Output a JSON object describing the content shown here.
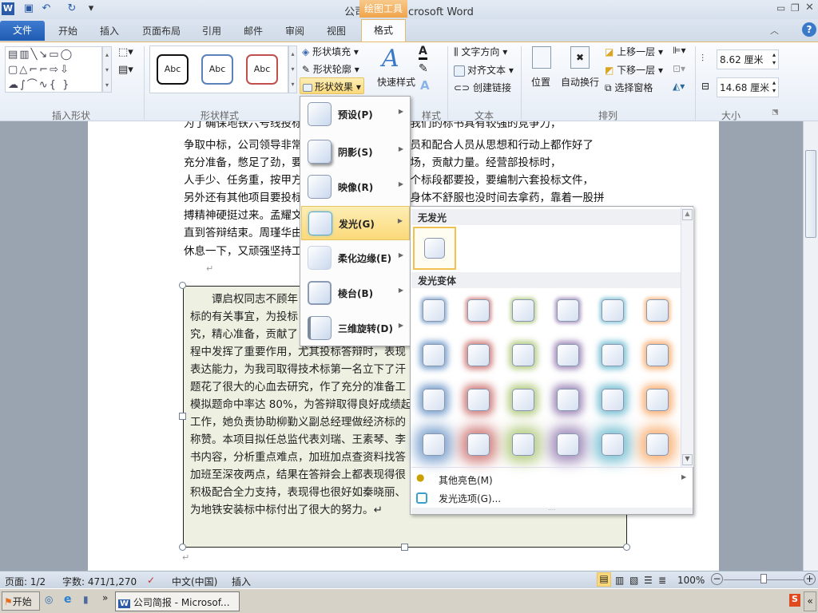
{
  "window": {
    "title": "公司简报 - Microsoft Word",
    "contextual_tab": "绘图工具",
    "controls": [
      "minimize",
      "restore",
      "close"
    ]
  },
  "quick_access": [
    "word-icon",
    "save-icon",
    "undo-icon",
    "redo-icon",
    "customize-icon"
  ],
  "tabs": {
    "file": "文件",
    "items": [
      "开始",
      "插入",
      "页面布局",
      "引用",
      "邮件",
      "审阅",
      "视图"
    ],
    "active": "格式"
  },
  "ribbon": {
    "insert_shapes": {
      "label": "插入形状"
    },
    "shape_styles": {
      "label": "形状样式",
      "gallery": [
        "Abc",
        "Abc",
        "Abc"
      ],
      "fill": "形状填充",
      "outline": "形状轮廓",
      "effects": "形状效果"
    },
    "wordart": {
      "quick_styles": "快速样式",
      "label": "样式"
    },
    "text": {
      "label": "文本",
      "direction": "文字方向",
      "align": "对齐文本",
      "link": "创建链接"
    },
    "arrange": {
      "label": "排列",
      "position": "位置",
      "wrap": "自动换行",
      "forward": "上移一层",
      "backward": "下移一层",
      "pane": "选择窗格"
    },
    "size": {
      "label": "大小",
      "height": "8.62 厘米",
      "width": "14.68 厘米"
    }
  },
  "effects_menu": {
    "items": [
      {
        "label": "预设(P)"
      },
      {
        "label": "阴影(S)"
      },
      {
        "label": "映像(R)"
      },
      {
        "label": "发光(G)",
        "highlighted": true
      },
      {
        "label": "柔化边缘(E)"
      },
      {
        "label": "棱台(B)"
      },
      {
        "label": "三维旋转(D)"
      }
    ]
  },
  "glow_menu": {
    "no_glow_header": "无发光",
    "variants_header": "发光变体",
    "colors": [
      "#4f81bd",
      "#c0504d",
      "#9bbb59",
      "#8064a2",
      "#4bacc6",
      "#f79646"
    ],
    "sizes_pt": [
      5,
      8,
      11,
      18
    ],
    "more_colors": "其他亮色(M)",
    "options": "发光选项(G)..."
  },
  "document": {
    "lines": [
      "为了确保地铁六号线投标工作按时间进度，确保我们的标书具有较强的竞争力，",
      "争取中标，公司领导非常重视，要求参与投标人员和配合人员从思想和行动上都作好了",
      "充分准备，憋足了劲，要为本次投标工作大干一场，贡献力量。经营部投标时，",
      "人手少、任务重，按甲方要求，经营部技术标六个标段都要投，要编制六套投标文件，",
      "另外还有其他项目要投标，大家加班加点工作，身体不舒服也没时间去拿药，靠着一股拼",
      "搏精神硬挺过来。孟耀文",
      "直到答辩结束。周瑾华由",
      "休息一下，又顽强坚持工"
    ],
    "textbox_lines": [
      "　　谭启权同志不顾年",
      "标的有关事宜，为投标",
      "究，精心准备，贡献了",
      "程中发挥了重要作用，尤其投标答辩时，表现",
      "表达能力，为我司取得技术标第一名立下了汗",
      "题花了很大的心血去研究，作了充分的准备工",
      "模拟题命中率达 80%，为答辩取得良好成绩起",
      "工作，她负责协助柳勤义副总经理做经济标的",
      "称赞。本项目拟任总监代表刘瑞、王素琴、李",
      "书内容，分析重点难点，加班加点查资料找答",
      "加班至深夜两点，结果在答辩会上都表现得很",
      "积极配合全力支持，表现得也很好如秦晓丽、",
      "为地铁安装标中标付出了很大的努力。↵"
    ]
  },
  "status": {
    "page": "页面: 1/2",
    "words": "字数: 471/1,270",
    "language": "中文(中国)",
    "mode": "插入",
    "zoom": "100%",
    "zoom_level": 100
  },
  "taskbar": {
    "start": "开始",
    "window": "公司简报 - Microsof..."
  }
}
